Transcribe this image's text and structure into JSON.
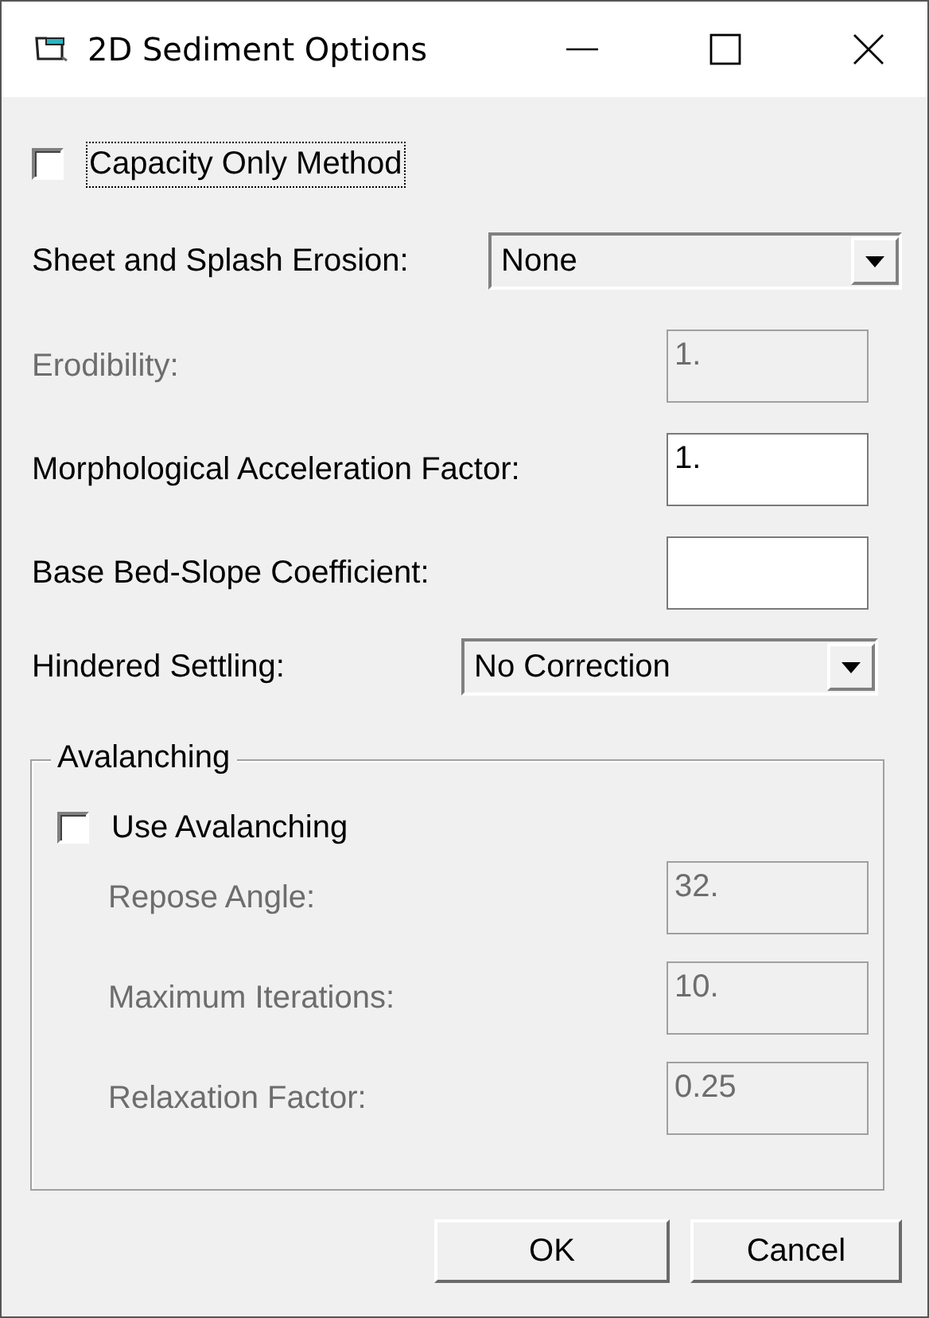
{
  "window": {
    "title": "2D Sediment Options"
  },
  "rows": [
    {
      "kind": "checkbox",
      "label": "Capacity Only Method",
      "checked": false,
      "focused": true
    },
    {
      "kind": "dropdown",
      "label": "Sheet and Splash Erosion:",
      "value": "None"
    },
    {
      "kind": "textbox",
      "label": "Erodibility:",
      "value": "1.",
      "disabled": true
    },
    {
      "kind": "textbox",
      "label": "Morphological Acceleration Factor:",
      "value": "1.",
      "disabled": false
    },
    {
      "kind": "textbox",
      "label": "Base Bed-Slope Coefficient:",
      "disabled": false
    },
    {
      "kind": "dropdown",
      "label": "Hindered Settling:",
      "value": "No Correction"
    }
  ],
  "group": {
    "title": "Avalanching",
    "rows": [
      {
        "kind": "checkbox",
        "label": "Use Avalanching",
        "checked": false,
        "focused": false
      },
      {
        "kind": "textbox",
        "label": "Repose Angle:",
        "value": "32.",
        "disabled": true
      },
      {
        "kind": "textbox",
        "label": "Maximum Iterations:",
        "value": "10.",
        "disabled": true
      },
      {
        "kind": "textbox",
        "label": "Relaxation Factor:",
        "value": "0.25",
        "disabled": true
      }
    ]
  },
  "buttons": [
    "OK",
    "Cancel"
  ]
}
